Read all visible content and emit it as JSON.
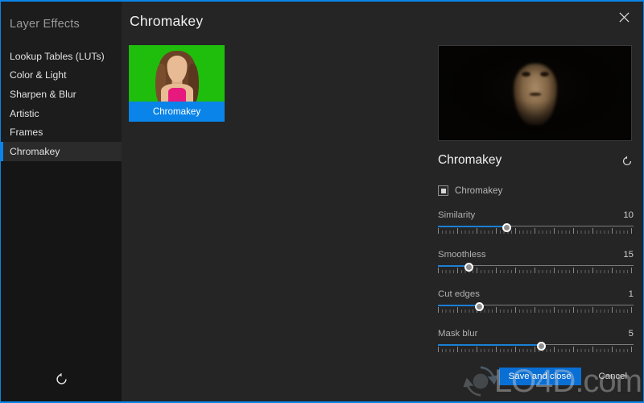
{
  "window": {
    "accent_color": "#0a84e8",
    "background": "#252525",
    "close_icon": "close-icon"
  },
  "sidebar": {
    "title": "Layer Effects",
    "items": [
      {
        "label": "Lookup Tables (LUTs)",
        "selected": false
      },
      {
        "label": "Color & Light",
        "selected": false
      },
      {
        "label": "Sharpen & Blur",
        "selected": false
      },
      {
        "label": "Artistic",
        "selected": false
      },
      {
        "label": "Frames",
        "selected": false
      },
      {
        "label": "Chromakey",
        "selected": true
      }
    ],
    "reset_icon": "reset-icon"
  },
  "main": {
    "page_title": "Chromakey",
    "effect_card": {
      "label": "Chromakey",
      "selected": true,
      "thumbnail": "green-screen-portrait-thumbnail"
    },
    "preview": {
      "alt": "dark-portrait-preview"
    }
  },
  "settings": {
    "title": "Chromakey",
    "reset_icon": "reset-icon",
    "enable_checkbox": {
      "label": "Chromakey",
      "checked": true
    },
    "sliders": [
      {
        "name": "Similarity",
        "value": "10",
        "percent": 35
      },
      {
        "name": "Smoothless",
        "value": "15",
        "percent": 16
      },
      {
        "name": "Cut edges",
        "value": "1",
        "percent": 21
      },
      {
        "name": "Mask blur",
        "value": "5",
        "percent": 53
      }
    ]
  },
  "footer": {
    "save_label": "Save and close",
    "cancel_label": "Cancel"
  },
  "watermark": {
    "text_main": "LO4D",
    "text_suffix": ".com"
  }
}
